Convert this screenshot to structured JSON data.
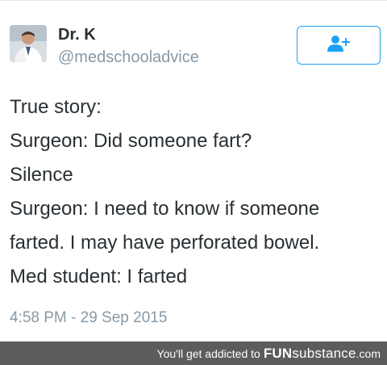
{
  "tweet": {
    "author": {
      "display_name": "Dr. K",
      "handle": "@medschooladvice",
      "avatar_icon": "profile-photo"
    },
    "follow_button_icon": "add-user-icon",
    "lines": [
      "True story:",
      "Surgeon: Did someone fart?",
      "Silence",
      "Surgeon: I need to know if someone",
      "farted. I may have perforated bowel.",
      "Med student: I farted"
    ],
    "timestamp": "4:58 PM - 29 Sep 2015"
  },
  "watermark": {
    "tagline": "You'll get addicted to",
    "brand_bold": "FUN",
    "brand_rest": "substance",
    "domain": ".com"
  },
  "colors": {
    "accent": "#1da1f2",
    "text": "#292f33",
    "muted": "#8899a6",
    "watermark_bg": "#5c5c5c"
  }
}
